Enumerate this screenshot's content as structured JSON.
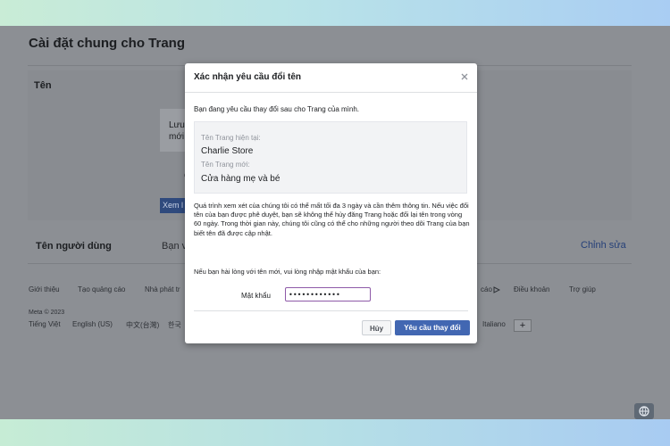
{
  "page": {
    "title": "Cài đặt chung cho Trang",
    "name_section_label": "Tên",
    "notice_fragment": "Lưu\nmới",
    "fragment_c": "C",
    "view_button": "Xem l",
    "username_label": "Tên người dùng",
    "username_value_fragment": "Bạn v",
    "edit_link": "Chỉnh sửa"
  },
  "footer": {
    "links_left": [
      "Giới thiệu",
      "Tạo quảng cáo",
      "Nhà phát tr"
    ],
    "links_right": [
      "cáo",
      "Điều khoản",
      "Trợ giúp"
    ],
    "meta": "Meta © 2023",
    "languages": [
      "Tiếng Việt",
      "English (US)",
      "中文(台灣)",
      "한국"
    ],
    "language_right": "Italiano",
    "add_language": "+"
  },
  "modal": {
    "title": "Xác nhận yêu cầu đổi tên",
    "intro": "Bạn đang yêu cầu thay đổi sau cho Trang của mình.",
    "current_name_label": "Tên Trang hiện tại:",
    "current_name": "Charlie Store",
    "new_name_label": "Tên Trang mới:",
    "new_name": "Cửa hàng mẹ và bé",
    "review_text": "Quá trình xem xét của chúng tôi có thể mất tối đa 3 ngày và cần thêm thông tin. Nếu việc đổi tên của bạn được phê duyệt, bạn sẽ không thể hủy đăng Trang hoặc đổi lại tên trong vòng 60 ngày. Trong thời gian này, chúng tôi cũng có thể cho những người theo dõi Trang của bạn biết tên đã được cập nhật.",
    "prompt": "Nếu bạn hài lòng với tên mới, vui lòng nhập mật khẩu của bạn:",
    "password_label": "Mật khẩu",
    "password_value": "••••••••••••",
    "cancel_label": "Hủy",
    "submit_label": "Yêu cầu thay đổi"
  },
  "icons": {
    "close": "close-icon",
    "globe": "globe-icon",
    "report": "report-icon"
  },
  "colors": {
    "primary_button": "#4267b2",
    "input_focus": "#8e5aa8"
  }
}
